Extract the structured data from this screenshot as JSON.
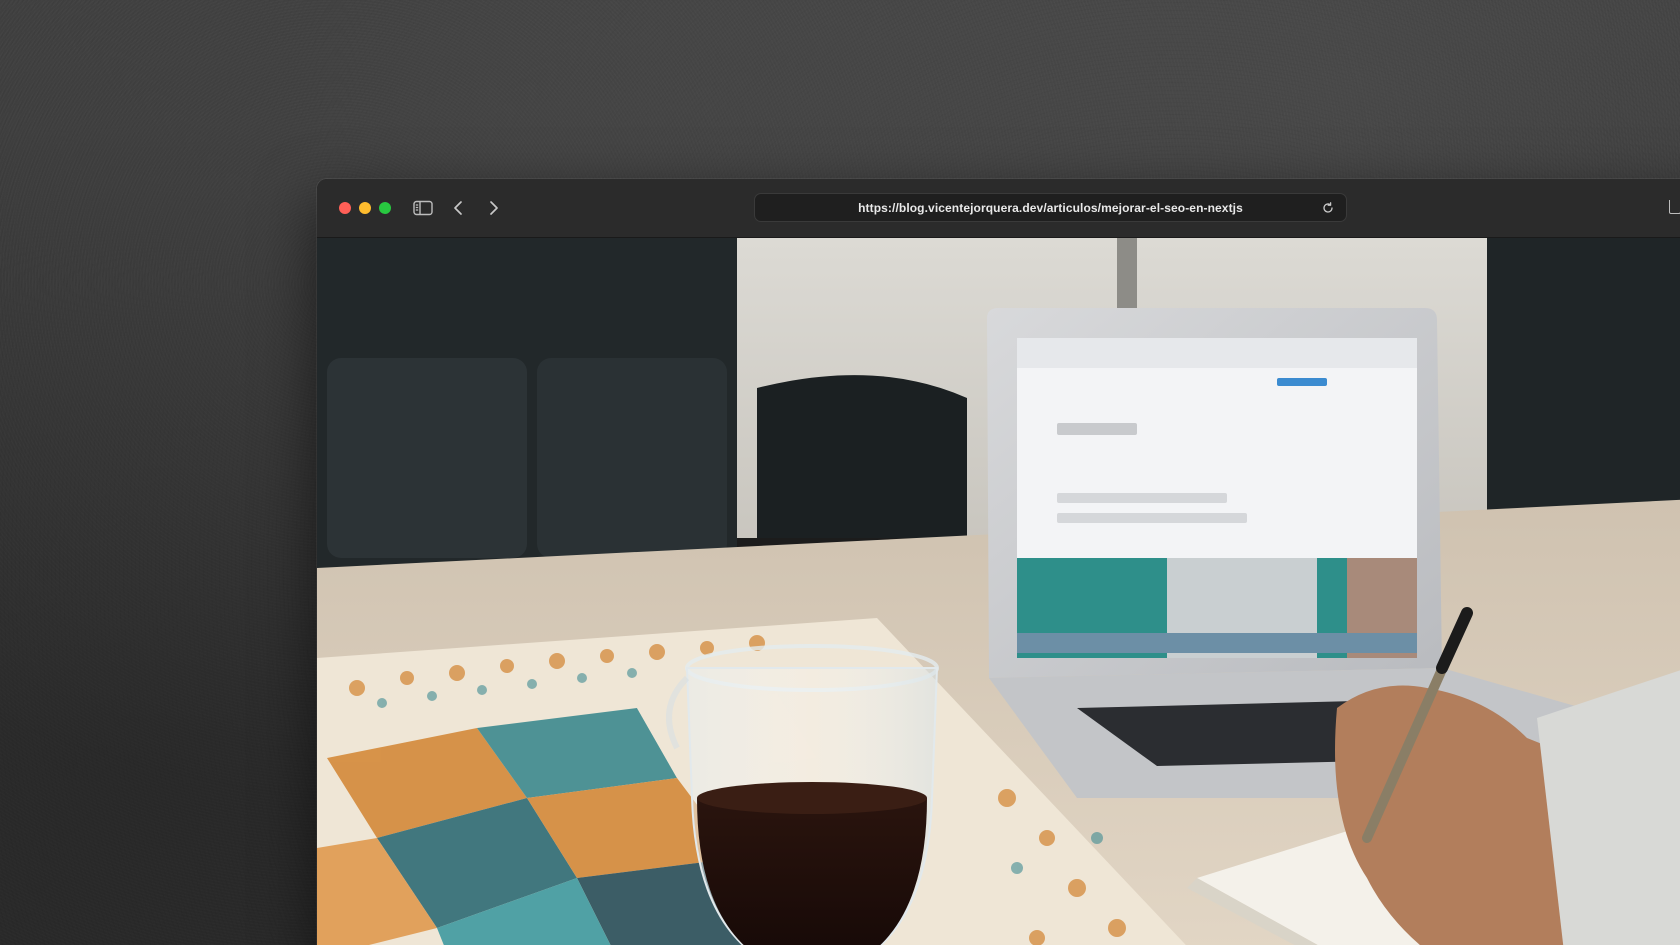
{
  "browser": {
    "url": "https://blog.vicentejorquera.dev/articulos/mejorar-el-seo-en-nextjs"
  },
  "hero_image": {
    "subject": "desk-with-laptop-coffee-and-notebook"
  },
  "icons": {
    "sidebar": "sidebar-icon",
    "back": "chevron-left-icon",
    "forward": "chevron-right-icon",
    "reload": "reload-icon",
    "share": "share-icon"
  },
  "colors": {
    "close": "#ff5f57",
    "minimize": "#febc2e",
    "maximize": "#28c840",
    "toolbar": "#2b2b2b",
    "backdrop": "#3f3f3f"
  }
}
